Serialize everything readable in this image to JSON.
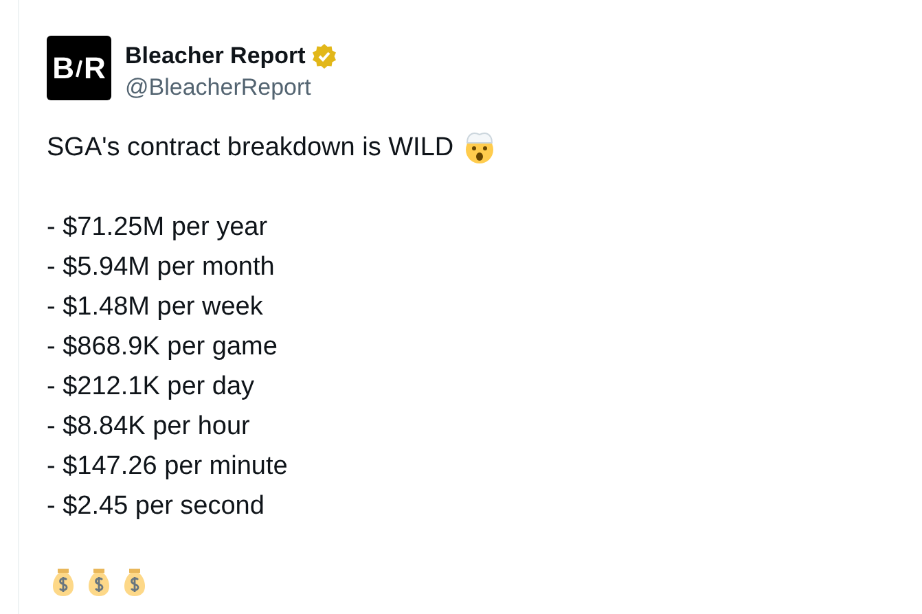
{
  "author": {
    "name": "Bleacher Report",
    "handle": "@BleacherReport",
    "verified": true,
    "logo_left": "B",
    "logo_right": "R"
  },
  "text": "SGA's contract breakdown is WILD",
  "lines": [
    "- $71.25M per year",
    "- $5.94M per month",
    "- $1.48M per week",
    "- $868.9K per game",
    "- $212.1K per day",
    "- $8.84K per hour",
    "- $147.26 per minute",
    "- $2.45 per second"
  ]
}
